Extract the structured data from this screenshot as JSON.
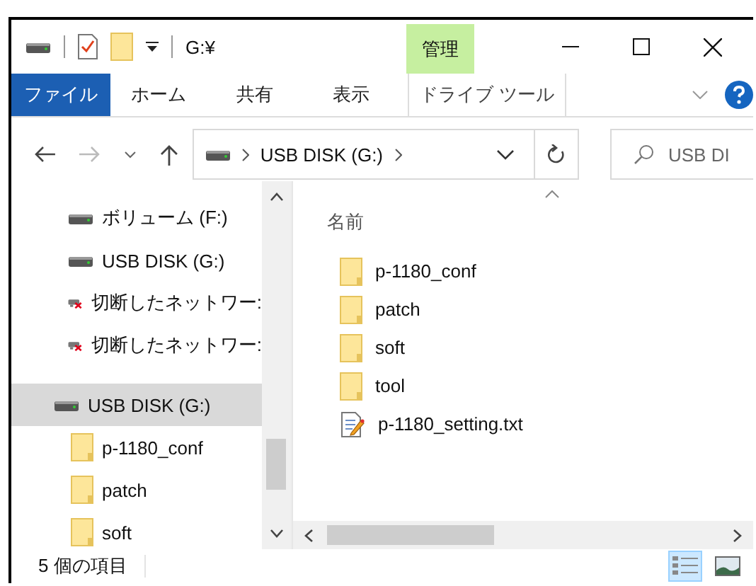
{
  "window": {
    "title": "G:¥",
    "context_label": "管理"
  },
  "ribbon": {
    "tabs": [
      {
        "label": "ファイル",
        "kind": "file_menu"
      },
      {
        "label": "ホーム",
        "kind": "tab"
      },
      {
        "label": "共有",
        "kind": "tab"
      },
      {
        "label": "表示",
        "kind": "tab"
      },
      {
        "label": "ドライブ ツール",
        "kind": "context"
      }
    ]
  },
  "address": {
    "path": [
      "USB DISK (G:)"
    ]
  },
  "search": {
    "placeholder": "USB DI"
  },
  "sidebar": {
    "items": [
      {
        "label": "ボリューム (F:)",
        "kind": "drive",
        "selected": false
      },
      {
        "label": "USB DISK (G:)",
        "kind": "drive",
        "selected": false
      },
      {
        "label": "切断したネットワー:",
        "kind": "disconnected",
        "selected": false
      },
      {
        "label": "切断したネットワー:",
        "kind": "disconnected",
        "selected": false
      },
      {
        "label": "USB DISK (G:)",
        "kind": "drive",
        "selected": true,
        "children": [
          {
            "label": "p-1180_conf",
            "kind": "folder",
            "selected": false
          },
          {
            "label": "patch",
            "kind": "folder",
            "selected": false
          },
          {
            "label": "soft",
            "kind": "folder",
            "selected": false
          }
        ]
      }
    ]
  },
  "file_list": {
    "columns": [
      "名前"
    ],
    "rows": [
      {
        "name": "p-1180_conf",
        "kind": "folder"
      },
      {
        "name": "patch",
        "kind": "folder"
      },
      {
        "name": "soft",
        "kind": "folder"
      },
      {
        "name": "tool",
        "kind": "folder"
      },
      {
        "name": "p-1180_setting.txt",
        "kind": "text"
      }
    ]
  },
  "status_bar": {
    "item_count": "5 個の項目"
  },
  "view_buttons": [
    {
      "kind": "details",
      "selected": true
    },
    {
      "kind": "large_icons",
      "selected": false
    }
  ]
}
